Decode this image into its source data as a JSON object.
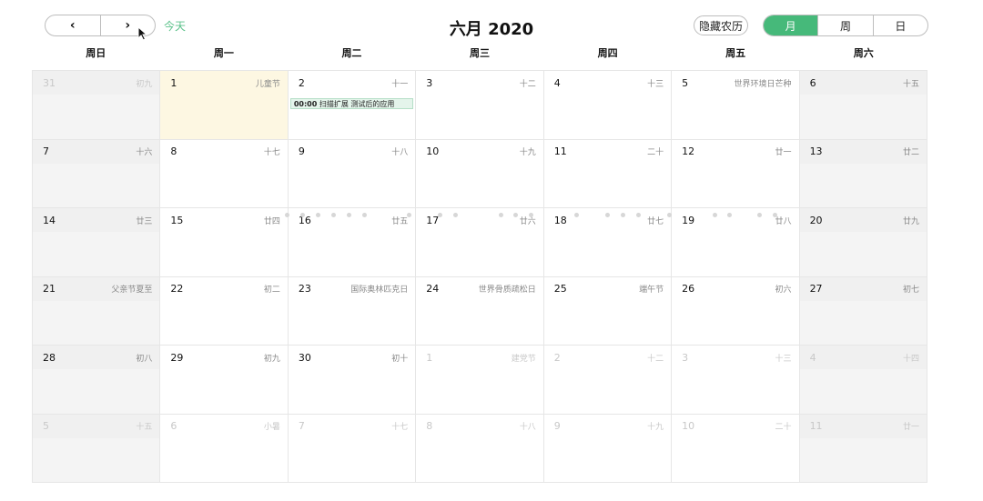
{
  "toolbar": {
    "prev_label": "‹",
    "next_label": "›",
    "today_label": "今天",
    "title": "六月 2020",
    "lunar_toggle_label": "隐藏农历",
    "views": [
      {
        "label": "月",
        "active": true
      },
      {
        "label": "周",
        "active": false
      },
      {
        "label": "日",
        "active": false
      }
    ]
  },
  "colors": {
    "accent": "#46b97a",
    "today_bg": "#fdf7e2",
    "weekend_bg": "#f4f4f4",
    "event_bg": "#e4f4eb"
  },
  "weekdays": [
    "周日",
    "周一",
    "周二",
    "周三",
    "周四",
    "周五",
    "周六"
  ],
  "weeks": [
    [
      {
        "day": "31",
        "lunar": "初九",
        "other": true
      },
      {
        "day": "1",
        "lunar": "儿童节",
        "today": true
      },
      {
        "day": "2",
        "lunar": "十一",
        "event": {
          "time": "00:00",
          "title": "扫描扩展 测试后的应用"
        }
      },
      {
        "day": "3",
        "lunar": "十二"
      },
      {
        "day": "4",
        "lunar": "十三"
      },
      {
        "day": "5",
        "lunar": "世界环境日芒种"
      },
      {
        "day": "6",
        "lunar": "十五"
      }
    ],
    [
      {
        "day": "7",
        "lunar": "十六"
      },
      {
        "day": "8",
        "lunar": "十七"
      },
      {
        "day": "9",
        "lunar": "十八"
      },
      {
        "day": "10",
        "lunar": "十九"
      },
      {
        "day": "11",
        "lunar": "二十"
      },
      {
        "day": "12",
        "lunar": "廿一"
      },
      {
        "day": "13",
        "lunar": "廿二"
      }
    ],
    [
      {
        "day": "14",
        "lunar": "廿三"
      },
      {
        "day": "15",
        "lunar": "廿四"
      },
      {
        "day": "16",
        "lunar": "廿五"
      },
      {
        "day": "17",
        "lunar": "廿六"
      },
      {
        "day": "18",
        "lunar": "廿七"
      },
      {
        "day": "19",
        "lunar": "廿八"
      },
      {
        "day": "20",
        "lunar": "廿九"
      }
    ],
    [
      {
        "day": "21",
        "lunar": "父亲节夏至"
      },
      {
        "day": "22",
        "lunar": "初二"
      },
      {
        "day": "23",
        "lunar": "国际奥林匹克日"
      },
      {
        "day": "24",
        "lunar": "世界骨质疏松日"
      },
      {
        "day": "25",
        "lunar": "端午节"
      },
      {
        "day": "26",
        "lunar": "初六"
      },
      {
        "day": "27",
        "lunar": "初七"
      }
    ],
    [
      {
        "day": "28",
        "lunar": "初八"
      },
      {
        "day": "29",
        "lunar": "初九"
      },
      {
        "day": "30",
        "lunar": "初十"
      },
      {
        "day": "1",
        "lunar": "建党节",
        "other": true
      },
      {
        "day": "2",
        "lunar": "十二",
        "other": true
      },
      {
        "day": "3",
        "lunar": "十三",
        "other": true
      },
      {
        "day": "4",
        "lunar": "十四",
        "other": true
      }
    ],
    [
      {
        "day": "5",
        "lunar": "十五",
        "other": true
      },
      {
        "day": "6",
        "lunar": "小暑",
        "other": true
      },
      {
        "day": "7",
        "lunar": "十七",
        "other": true
      },
      {
        "day": "8",
        "lunar": "十八",
        "other": true
      },
      {
        "day": "9",
        "lunar": "十九",
        "other": true
      },
      {
        "day": "10",
        "lunar": "二十",
        "other": true
      },
      {
        "day": "11",
        "lunar": "廿一",
        "other": true
      }
    ]
  ]
}
